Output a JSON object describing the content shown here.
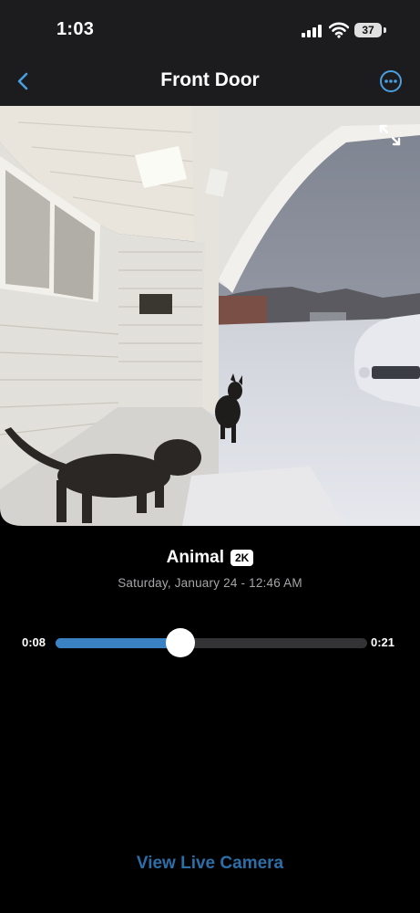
{
  "status_bar": {
    "time": "1:03",
    "battery": "37"
  },
  "nav": {
    "title": "Front Door"
  },
  "event": {
    "type": "Animal",
    "quality": "2K",
    "datetime": "Saturday, January 24 - 12:46 AM"
  },
  "player": {
    "current_time": "0:08",
    "end_time": "0:21",
    "progress": 0.4
  },
  "actions": {
    "view_live": "View Live Camera"
  },
  "colors": {
    "accent": "#3b82c4",
    "link": "#2c6ea8",
    "nav_icon": "#4a9fe0"
  },
  "icons": [
    "chevron-left-icon",
    "more-icon",
    "fullscreen-icon",
    "signal-icon",
    "wifi-icon",
    "battery-icon"
  ]
}
